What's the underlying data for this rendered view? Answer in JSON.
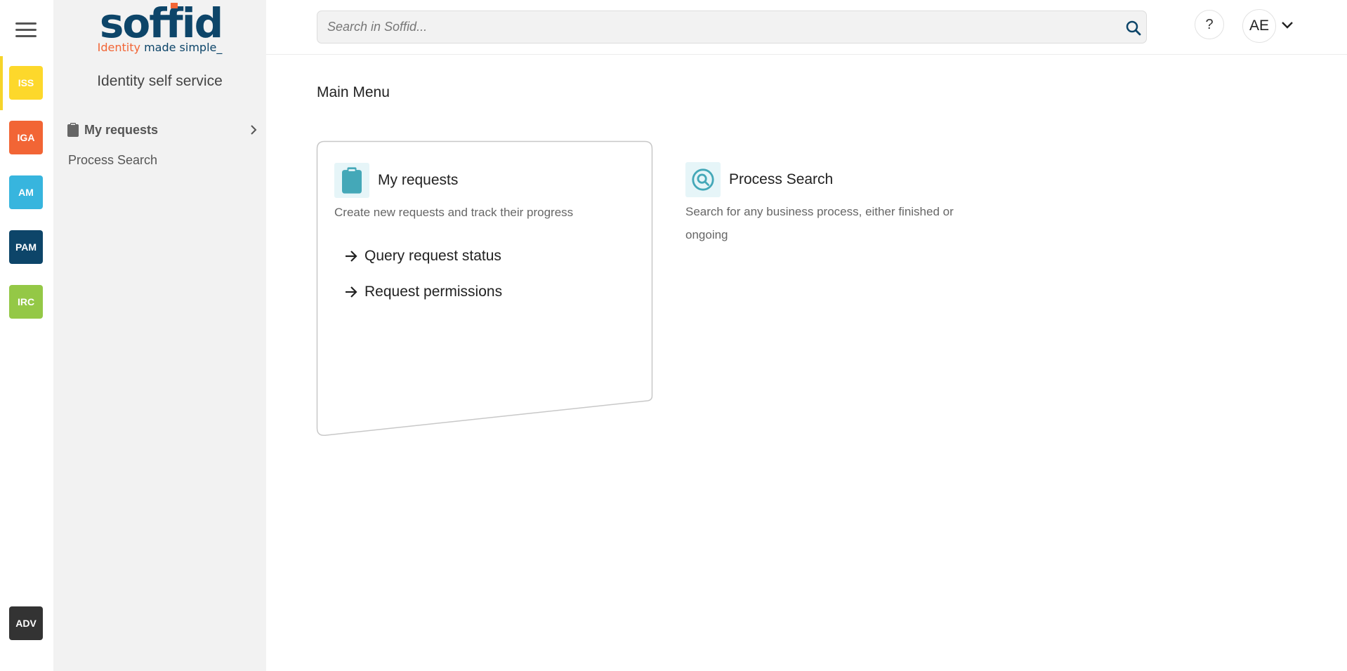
{
  "apps": [
    {
      "code": "ISS",
      "color": "#fdd82b"
    },
    {
      "code": "IGA",
      "color": "#f26535"
    },
    {
      "code": "AM",
      "color": "#37b5de"
    },
    {
      "code": "PAM",
      "color": "#0d4569"
    },
    {
      "code": "IRC",
      "color": "#94c846"
    },
    {
      "code": "ADV",
      "color": "#333333"
    }
  ],
  "logo": {
    "word": "soffid",
    "tagline_part1": "Identity",
    "tagline_part2": "made simple_",
    "primary_color": "#0d4569",
    "accent_color": "#f26535"
  },
  "sidebar": {
    "module_title": "Identity self service",
    "items": [
      {
        "label": "My requests",
        "icon": "clipboard-icon"
      },
      {
        "label": "Process Search"
      }
    ]
  },
  "topbar": {
    "search_placeholder": "Search in Soffid...",
    "help_label": "?",
    "user_initials": "AE"
  },
  "main": {
    "title": "Main Menu",
    "cards": [
      {
        "title": "My requests",
        "icon": "clipboard-icon",
        "description": "Create new requests and track their progress",
        "links": [
          "Query request status",
          "Request permissions"
        ]
      },
      {
        "title": "Process Search",
        "icon": "process-search-icon",
        "description": "Search for any business process, either finished or ongoing",
        "links": []
      }
    ]
  },
  "colors": {
    "accent_teal": "#44a8b8",
    "sidebar_bg": "#f2f2f2",
    "active_indicator": "#f6d42a"
  }
}
